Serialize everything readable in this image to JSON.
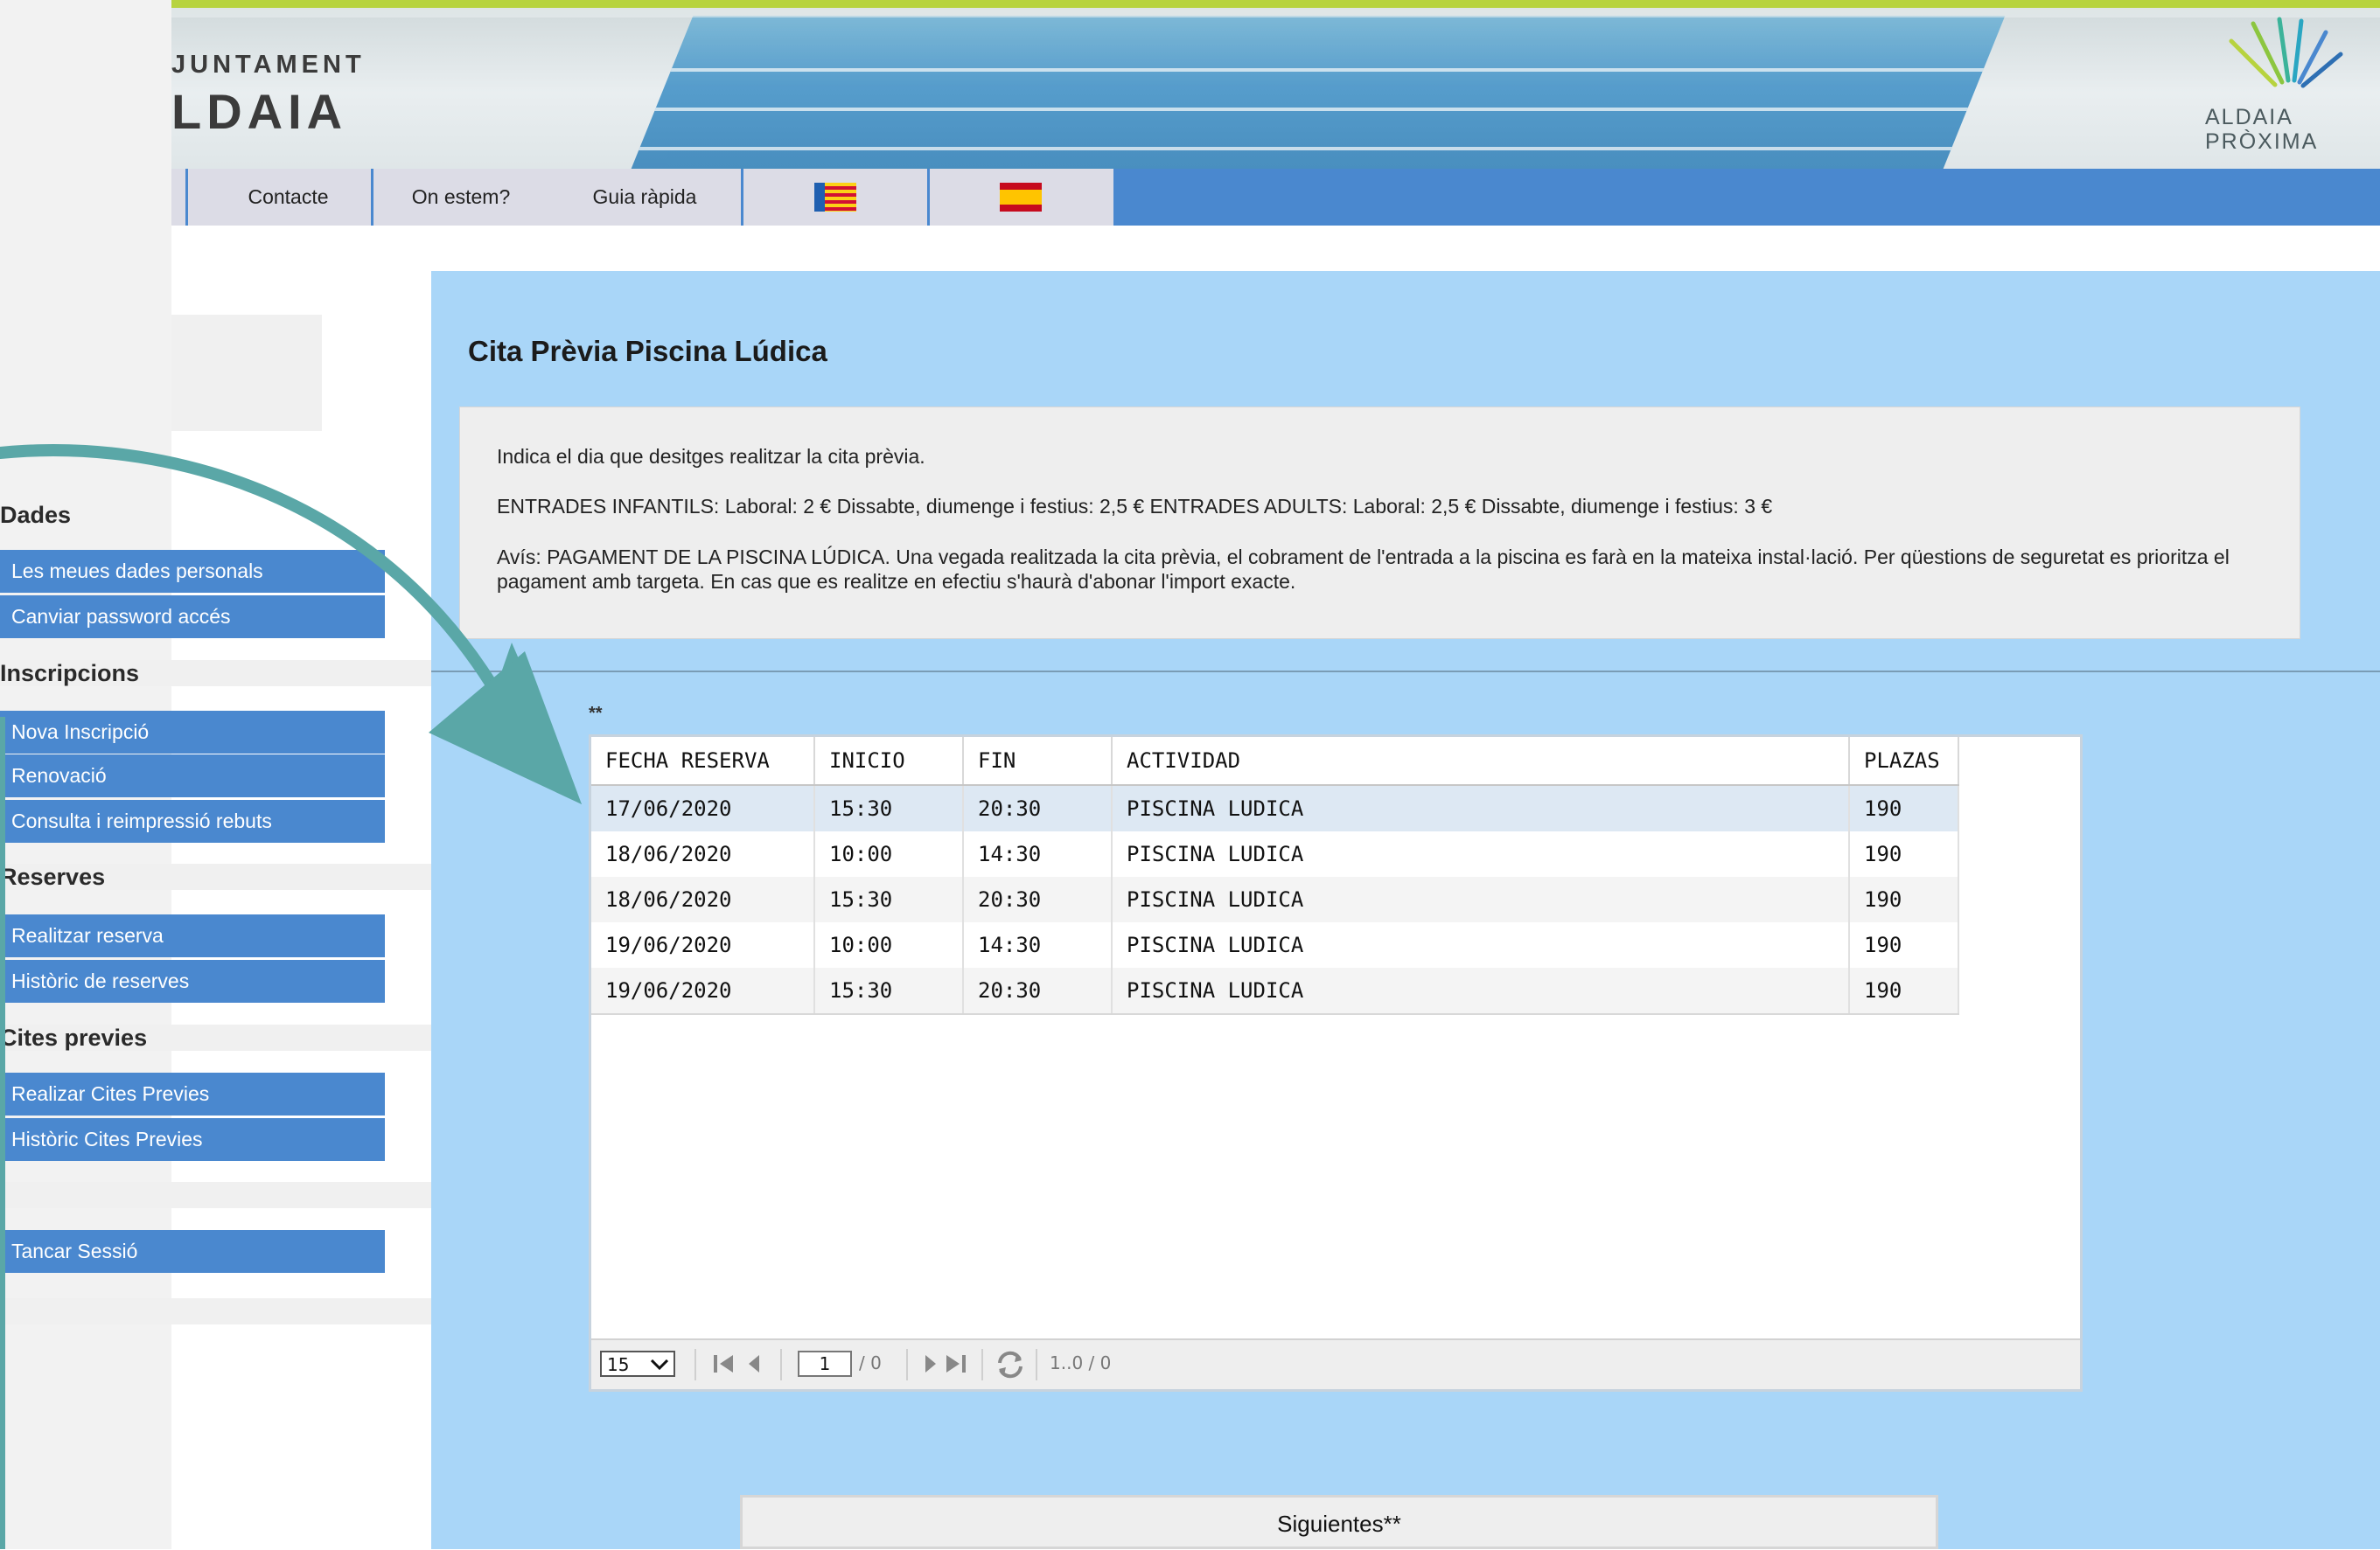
{
  "header": {
    "logo_line1": "JUNTAMENT",
    "logo_line2": "LDAIA",
    "proxima_line1": "ALDAIA",
    "proxima_line2": "PRÒXIMA"
  },
  "nav": {
    "items": [
      "Contacte",
      "On estem?",
      "Guia ràpida"
    ],
    "flags": [
      "valencian-flag-icon",
      "spanish-flag-icon"
    ]
  },
  "sidebar": {
    "sections": [
      {
        "title": "Dades",
        "items": [
          "Les meues dades personals",
          "Canviar password accés"
        ]
      },
      {
        "title": "Inscripcions",
        "items": [
          "Nova Inscripció",
          "Renovació",
          "Consulta i reimpressió rebuts"
        ]
      },
      {
        "title": "Reserves",
        "items": [
          "Realitzar reserva",
          "Històric de reserves"
        ]
      },
      {
        "title": "Cites previes",
        "items": [
          "Realizar Cites Previes",
          "Històric Cites Previes"
        ]
      }
    ],
    "logout": "Tancar Sessió"
  },
  "main": {
    "title": "Cita Prèvia Piscina Lúdica",
    "info": [
      "Indica el dia que desitges realitzar la cita prèvia.",
      "ENTRADES INFANTILS: Laboral: 2 € Dissabte, diumenge i festius: 2,5 € ENTRADES ADULTS: Laboral: 2,5 € Dissabte, diumenge i festius: 3 €",
      "Avís: PAGAMENT DE LA PISCINA LÚDICA. Una vegada realitzada la cita prèvia, el cobrament de l'entrada a la piscina es farà en la mateixa instal·lació. Per qüestions de seguretat es prioritza el pagament amb targeta. En cas que es realitze en efectiu s'haurà d'abonar l'import exacte."
    ],
    "stars": "**",
    "table": {
      "headers": [
        "FECHA RESERVA",
        "INICIO",
        "FIN",
        "ACTIVIDAD",
        "PLAZAS"
      ],
      "rows": [
        [
          "17/06/2020",
          "15:30",
          "20:30",
          "PISCINA LUDICA",
          "190"
        ],
        [
          "18/06/2020",
          "10:00",
          "14:30",
          "PISCINA LUDICA",
          "190"
        ],
        [
          "18/06/2020",
          "15:30",
          "20:30",
          "PISCINA LUDICA",
          "190"
        ],
        [
          "19/06/2020",
          "10:00",
          "14:30",
          "PISCINA LUDICA",
          "190"
        ],
        [
          "19/06/2020",
          "15:30",
          "20:30",
          "PISCINA LUDICA",
          "190"
        ]
      ]
    },
    "pager": {
      "page_size": "15",
      "page": "1",
      "of": "/ 0",
      "range": "1..0 / 0"
    },
    "next_button": "Siguientes**"
  },
  "colors": {
    "nav_blue": "#4a88cf",
    "panel_blue": "#a9d6f8",
    "arrow_teal": "#5aa7a7",
    "top_green": "#b7d33f"
  }
}
